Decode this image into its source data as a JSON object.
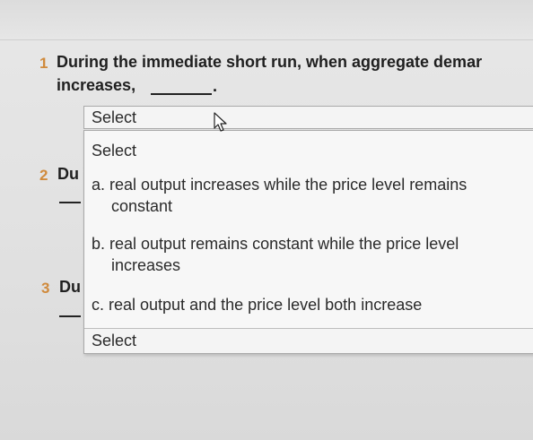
{
  "question1": {
    "number": "1",
    "line1": "During the immediate short run, when aggregate demar",
    "line2": "increases,"
  },
  "question2": {
    "number": "2",
    "text": "Du"
  },
  "question3": {
    "number": "3",
    "text": "Du"
  },
  "select": {
    "value": "Select"
  },
  "dropdown": {
    "header": "Select",
    "options": [
      {
        "line1": "a. real output increases while the price level remains",
        "line2": "constant"
      },
      {
        "line1": "b. real output remains constant while the price level",
        "line2": "increases"
      },
      {
        "line1": "c. real output and the price level both increase",
        "line2": ""
      }
    ],
    "footer": "Select"
  },
  "icons": {
    "cursor": "arrow-pointer-icon"
  }
}
